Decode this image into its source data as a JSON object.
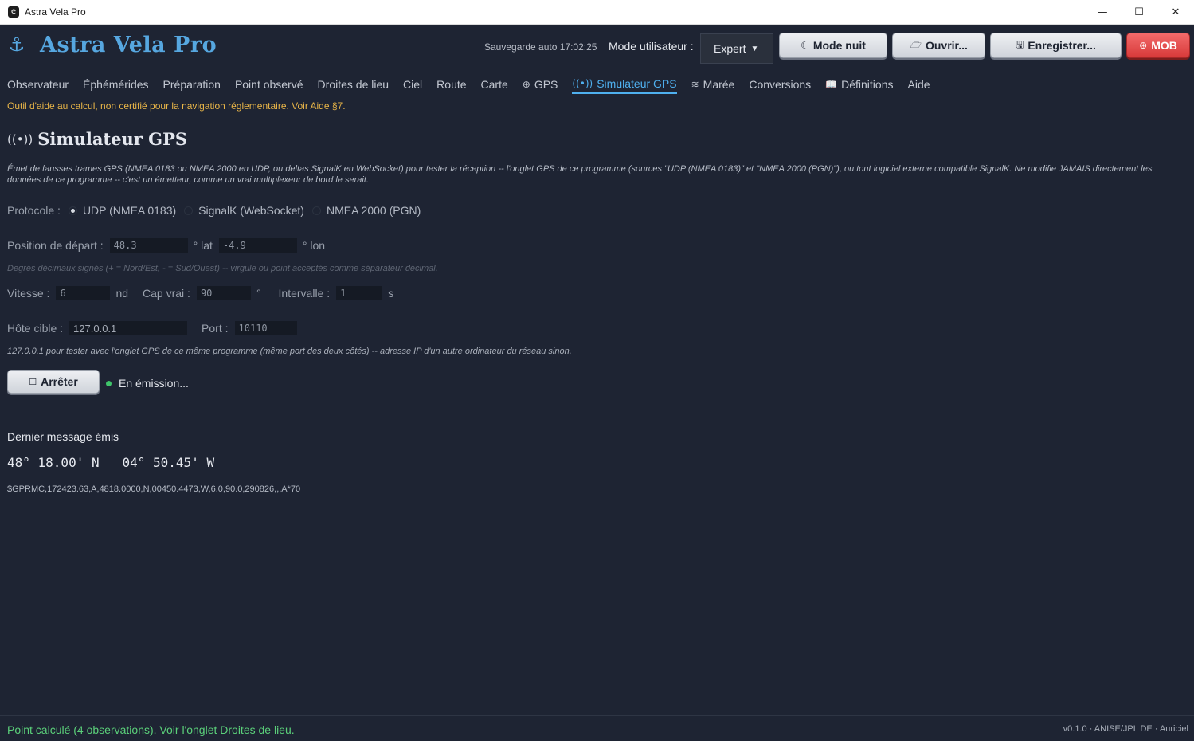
{
  "window": {
    "title": "Astra Vela Pro",
    "app_icon_glyph": "e",
    "minimize": "—",
    "maximize": "☐",
    "close": "✕"
  },
  "header": {
    "anchor_glyph": "⚓",
    "title": "Astra Vela Pro",
    "autosave": "Sauvegarde auto 17:02:25",
    "mode_label": "Mode utilisateur :",
    "mode_value": "Expert",
    "mode_caret": "▼",
    "buttons": {
      "night": {
        "icon": "☾",
        "label": "Mode nuit"
      },
      "open": {
        "icon": "🗁",
        "label": "Ouvrir..."
      },
      "save": {
        "icon": "🖫",
        "label": "Enregistrer..."
      },
      "mob": {
        "icon": "⊛",
        "label": "MOB"
      }
    }
  },
  "tabs": [
    {
      "icon": "",
      "label": "Observateur"
    },
    {
      "icon": "",
      "label": "Éphémérides"
    },
    {
      "icon": "",
      "label": "Préparation"
    },
    {
      "icon": "",
      "label": "Point observé"
    },
    {
      "icon": "",
      "label": "Droites de lieu"
    },
    {
      "icon": "",
      "label": "Ciel"
    },
    {
      "icon": "",
      "label": "Route"
    },
    {
      "icon": "",
      "label": "Carte"
    },
    {
      "icon": "⊕",
      "label": "GPS"
    },
    {
      "icon": "((•))",
      "label": "Simulateur GPS",
      "active": true
    },
    {
      "icon": "≋",
      "label": "Marée"
    },
    {
      "icon": "",
      "label": "Conversions"
    },
    {
      "icon": "📖",
      "label": "Définitions"
    },
    {
      "icon": "",
      "label": "Aide"
    }
  ],
  "warning": "Outil d'aide au calcul, non certifié pour la navigation réglementaire. Voir Aide §7.",
  "simulator": {
    "title_icon": "((•))",
    "title": "Simulateur GPS",
    "description": "Émet de fausses trames GPS (NMEA 0183 ou NMEA 2000 en UDP, ou deltas SignalK en WebSocket) pour tester la réception -- l'onglet GPS de ce programme (sources \"UDP (NMEA 0183)\" et \"NMEA 2000 (PGN)\"), ou tout logiciel externe compatible SignalK. Ne modifie JAMAIS directement les données de ce programme -- c'est un émetteur, comme un vrai multiplexeur de bord le serait.",
    "protocol_label": "Protocole :",
    "protocols": [
      {
        "label": "UDP (NMEA 0183)",
        "selected": true
      },
      {
        "label": "SignalK (WebSocket)",
        "selected": false
      },
      {
        "label": "NMEA 2000 (PGN)",
        "selected": false
      }
    ],
    "start_label": "Position de départ :",
    "lat_value": "48.3",
    "lat_unit": "° lat",
    "lon_value": "-4.9",
    "lon_unit": "° lon",
    "degrees_hint": "Degrés décimaux signés (+ = Nord/Est, - = Sud/Ouest) -- virgule ou point acceptés comme séparateur décimal.",
    "speed_label": "Vitesse :",
    "speed_value": "6",
    "speed_unit": "nd",
    "heading_label": "Cap vrai :",
    "heading_value": "90",
    "heading_unit": "°",
    "interval_label": "Intervalle :",
    "interval_value": "1",
    "interval_unit": "s",
    "host_label": "Hôte cible :",
    "host_value": "127.0.0.1",
    "port_label": "Port :",
    "port_value": "10110",
    "host_hint": "127.0.0.1 pour tester avec l'onglet GPS de ce même programme (même port des deux côtés) -- adresse IP d'un autre ordinateur du réseau sinon.",
    "stop_icon": "☐",
    "stop_label": "Arrêter",
    "status_text": "En émission...",
    "status_color": "#3fc46a",
    "last_label": "Dernier message émis",
    "last_coords": "48° 18.00' N   04° 50.45' W",
    "last_sentence": "$GPRMC,172423.63,A,4818.0000,N,00450.4473,W,6.0,90.0,290826,,,A*70"
  },
  "statusbar": {
    "left": "Point calculé (4 observations). Voir l'onglet Droites de lieu.",
    "right": "v0.1.0 · ANISE/JPL DE · Auriciel"
  },
  "colors": {
    "accent": "#4fb0ef",
    "warning": "#e8b548",
    "mob": "#d83a3a",
    "ok": "#5bd07a"
  }
}
